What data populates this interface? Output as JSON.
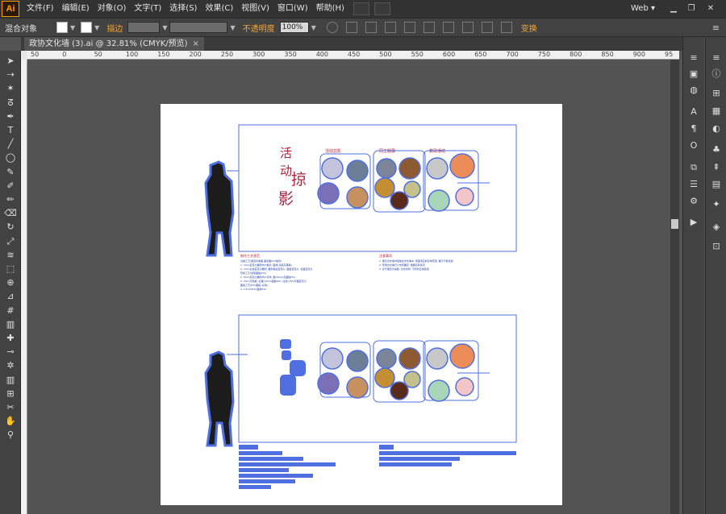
{
  "app": {
    "logo": "Ai",
    "workspace": "Web"
  },
  "menu": [
    "文件(F)",
    "编辑(E)",
    "对象(O)",
    "文字(T)",
    "选择(S)",
    "效果(C)",
    "视图(V)",
    "窗口(W)",
    "帮助(H)"
  ],
  "control": {
    "selection_label": "混合对象",
    "stroke_label": "描边",
    "opacity_label": "不透明度",
    "opacity_value": "100%",
    "transform_label": "变换"
  },
  "document": {
    "tab_title": "政协文化墙 (3).ai @ 32.81% (CMYK/预览)"
  },
  "rulers": {
    "h_ticks": [
      "50",
      "0",
      "50",
      "100",
      "150",
      "200",
      "250",
      "300",
      "350",
      "400",
      "450",
      "500",
      "550",
      "600",
      "650",
      "700",
      "750",
      "800",
      "850",
      "900",
      "95"
    ]
  },
  "artwork": {
    "heading_chars": [
      "活",
      "动",
      "掠",
      "影"
    ],
    "group_labels": [
      "活动剪影",
      "同主题展",
      "教政活动"
    ],
    "left_caption": "制作工艺规范",
    "right_caption": "注意事项",
    "notes_left": [
      "基础工艺(展室内墙面 面漆面PVC板喷)",
      "1. 3mm亚克力雕刻PVC板喷, 面材(墨底灰黑等)",
      "2. 3mm白色亚克力雕刻, 雕刻铣后亚克力, 面板亚克力, 表面亚克力",
      "形象工艺(成型面板PVC)",
      "1. 8mm亚克力雕刻PVC背材, 面10mm表面板PVC",
      "2. 3mm无色板 (表面) 8mm面板PVC (主色) PVC背面亚克力",
      "图案工艺(PVC面板, 彩色)",
      "3. 2.5mmPVC面积PVC"
    ],
    "notes_right": [
      "1. 展示文化墙内容放在文化墙中, 增强项目的影响范围, 展示不能遮挡",
      "2. 现场文化墙尺寸布局确定, 根据实际情况",
      "3. 基于展览方案数, 文化布局, 不影响正常使用"
    ]
  },
  "colors": {
    "accent_orange": "#f3a535",
    "selection_blue": "#4f6fe0",
    "heading_red": "#ad1f3a"
  },
  "icons": {
    "tools": [
      "selection-tool",
      "direct-selection-tool",
      "magic-wand-tool",
      "lasso-tool",
      "pen-tool",
      "type-tool",
      "line-tool",
      "ellipse-tool",
      "paintbrush-tool",
      "pencil-tool",
      "blob-brush-tool",
      "eraser-tool",
      "rotate-tool",
      "scale-tool",
      "width-tool",
      "free-transform-tool",
      "shape-builder-tool",
      "perspective-tool",
      "mesh-tool",
      "gradient-tool",
      "eyedropper-tool",
      "blend-tool",
      "symbol-sprayer-tool",
      "column-graph-tool",
      "artboard-tool",
      "slice-tool",
      "hand-tool",
      "zoom-tool"
    ]
  }
}
